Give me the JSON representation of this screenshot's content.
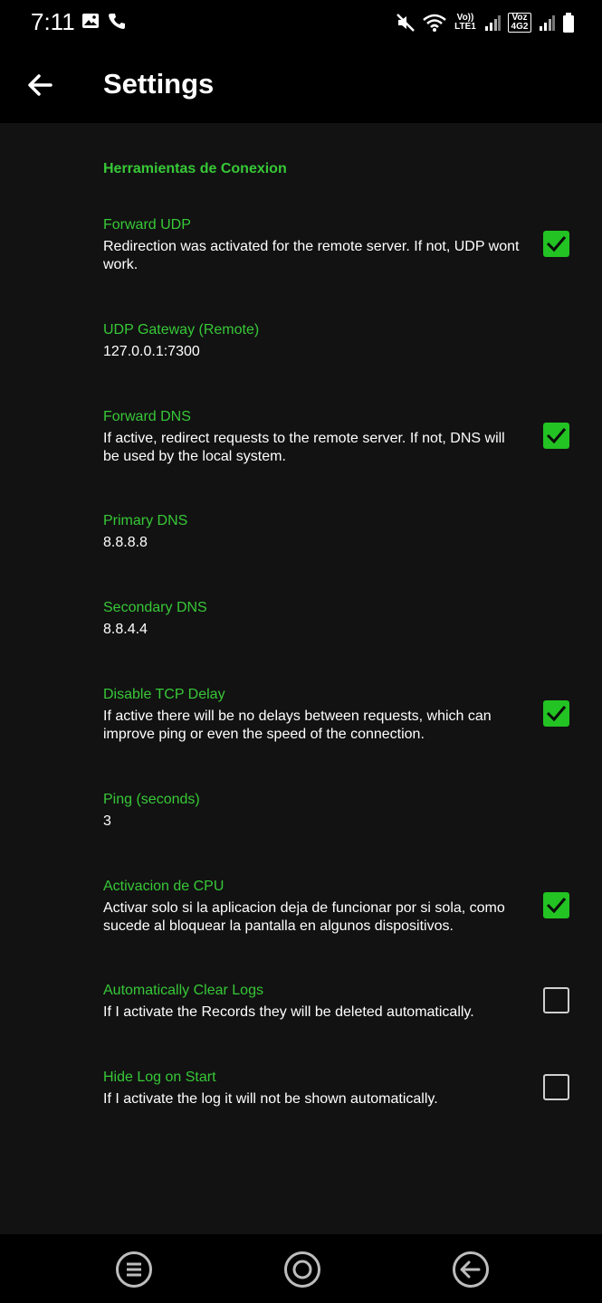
{
  "status_bar": {
    "time": "7:11",
    "network_label_1": "Vo)) LTE1",
    "network_label_2": "Voz 4G2",
    "icons": [
      "image-icon",
      "phone-icon",
      "mute-icon",
      "wifi-icon",
      "signal-icon",
      "battery-icon"
    ]
  },
  "app_bar": {
    "title": "Settings",
    "back_icon": "arrow-left-icon"
  },
  "category": "Herramientas de Conexion",
  "prefs": [
    {
      "title": "Forward UDP",
      "summary": "Redirection was activated for the remote server. If not, UDP wont work.",
      "checked": true
    },
    {
      "title": "UDP Gateway (Remote)",
      "summary": "127.0.0.1:7300"
    },
    {
      "title": "Forward DNS",
      "summary": "If active, redirect requests to the remote server. If not, DNS will be used by the local system.",
      "checked": true
    },
    {
      "title": "Primary DNS",
      "summary": "8.8.8.8"
    },
    {
      "title": "Secondary DNS",
      "summary": "8.8.4.4"
    },
    {
      "title": "Disable TCP Delay",
      "summary": "If active there will be no delays between requests, which can improve ping or even the speed of the connection.",
      "checked": true
    },
    {
      "title": "Ping (seconds)",
      "summary": "3"
    },
    {
      "title": "Activacion de CPU",
      "summary": "Activar solo si la aplicacion deja de funcionar por si sola, como sucede al bloquear la pantalla en algunos dispositivos.",
      "checked": true
    },
    {
      "title": "Automatically Clear Logs",
      "summary": "If I activate the Records they will be deleted automatically.",
      "checked": false
    },
    {
      "title": "Hide Log on Start",
      "summary": "If I activate the log it will not be shown automatically.",
      "checked": false
    }
  ],
  "nav_bar": {
    "icons": [
      "recents-icon",
      "home-icon",
      "back-icon"
    ]
  },
  "colors": {
    "accent": "#37c837",
    "checkbox_on": "#22c322",
    "background": "#121212",
    "bar": "#000000"
  }
}
